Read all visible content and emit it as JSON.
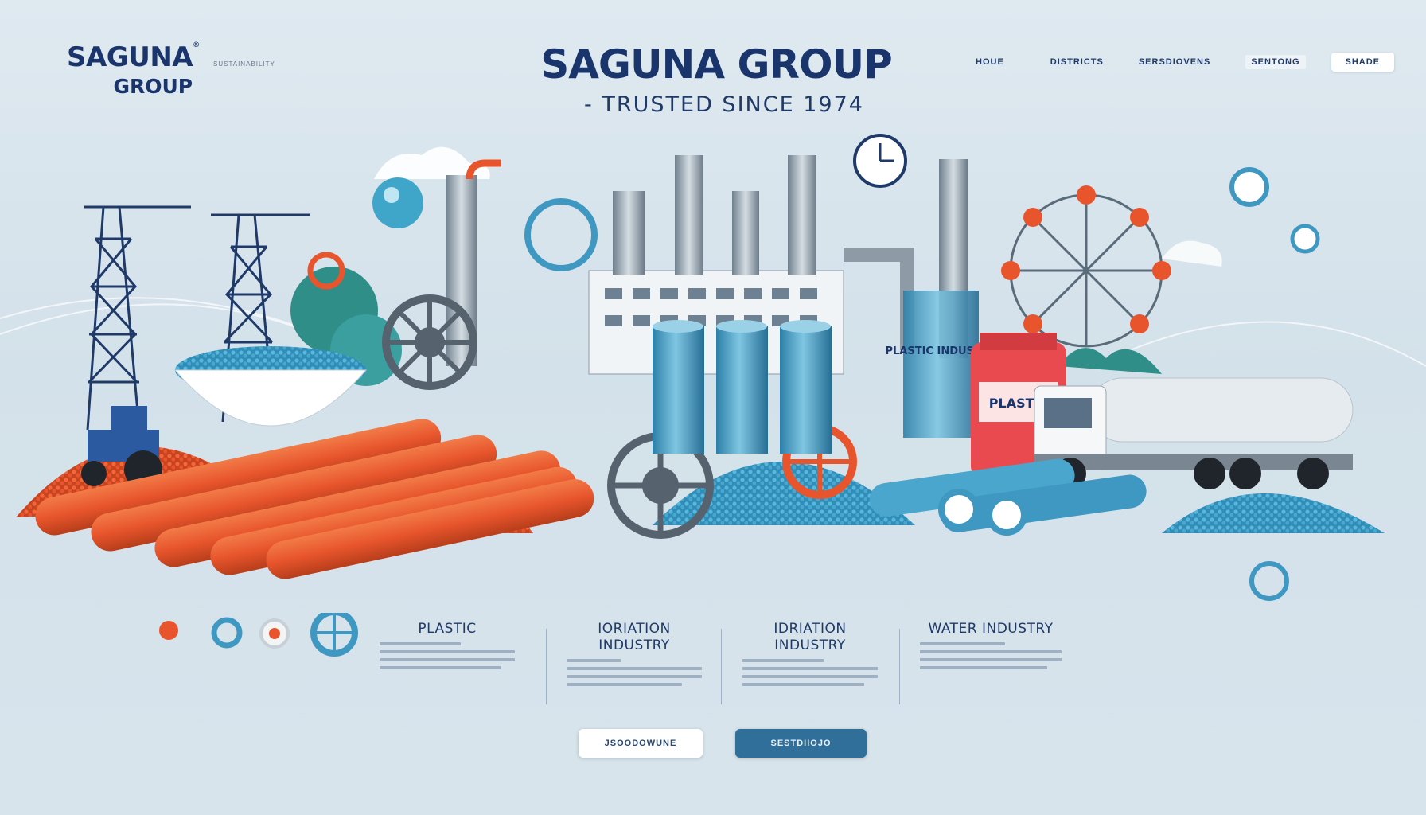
{
  "brand": {
    "name_line1": "SAGUNA",
    "name_line2": "GROUP",
    "trademark": "®",
    "tagline": "SUSTAINABILITY"
  },
  "hero": {
    "title": "SAGUNA GROUP",
    "subtitle": "- TRUSTED SINCE 1974"
  },
  "nav": {
    "items": [
      "HOUE",
      "DISTRICTS",
      "SERSDIOVENS",
      "SENTONG",
      "SHADE"
    ]
  },
  "illustration": {
    "labels": {
      "plastic_drum": "PLASTIC INDUSTRY",
      "jar": "PLASTIC"
    },
    "colors": {
      "orange": "#e8552c",
      "blue": "#3fa6c9",
      "navy": "#1a356b",
      "steel": "#9aa8b4"
    }
  },
  "categories": [
    {
      "title": "PLASTIC"
    },
    {
      "title": "IORIATION INDUSTRY"
    },
    {
      "title": "IDRIATION INDUSTRY"
    },
    {
      "title": "WATER INDUSTRY"
    }
  ],
  "buttons": {
    "primary": "JSOODOWUNE",
    "secondary": "SESTDIIOJO"
  }
}
